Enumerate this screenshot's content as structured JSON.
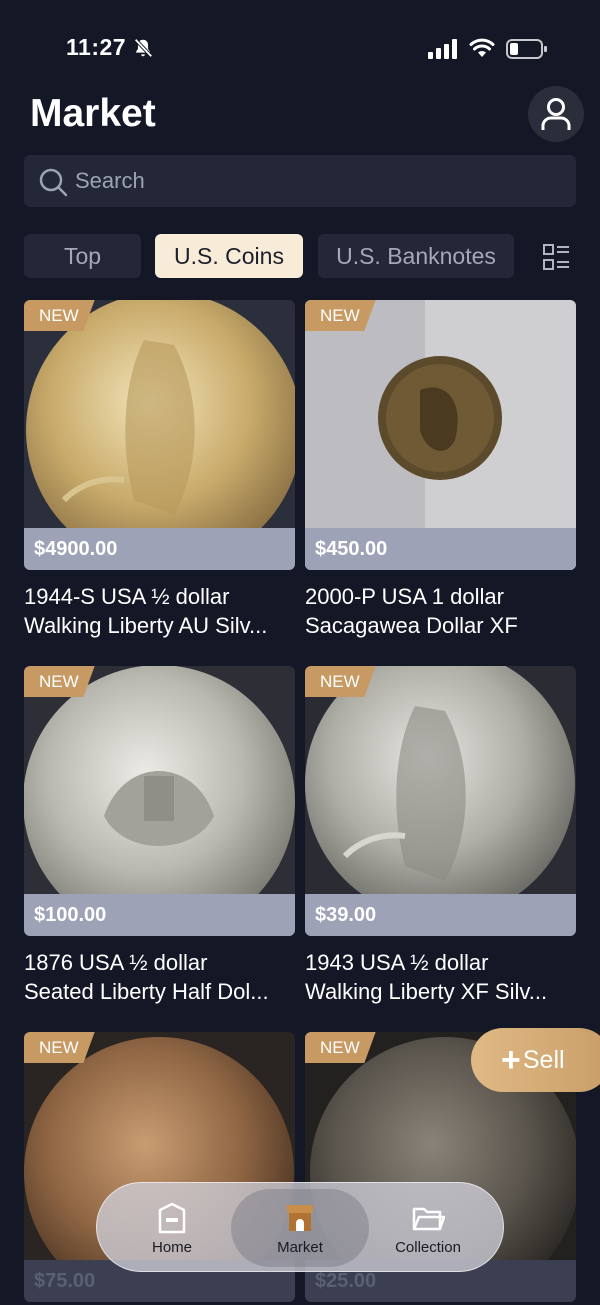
{
  "status_bar": {
    "time": "11:27",
    "icons": [
      "bell-slash-icon",
      "signal-icon",
      "wifi-icon",
      "battery-icon"
    ]
  },
  "header": {
    "title": "Market",
    "avatar_icon": "person-icon"
  },
  "search": {
    "placeholder": "Search",
    "icon": "search-icon"
  },
  "tabs": [
    {
      "label": "Top",
      "active": false
    },
    {
      "label": "U.S. Coins",
      "active": true
    },
    {
      "label": "U.S. Banknotes",
      "active": false
    }
  ],
  "layout_toggle_icon": "list-grid-icon",
  "listings": [
    {
      "badge": "NEW",
      "price": "$4900.00",
      "title_line1": "1944-S USA ½ dollar",
      "title_line2": "Walking Liberty AU Silv..."
    },
    {
      "badge": "NEW",
      "price": "$450.00",
      "title_line1": "2000-P USA 1 dollar",
      "title_line2": "Sacagawea Dollar XF"
    },
    {
      "badge": "NEW",
      "price": "$100.00",
      "title_line1": "1876 USA ½ dollar",
      "title_line2": "Seated Liberty Half Dol..."
    },
    {
      "badge": "NEW",
      "price": "$39.00",
      "title_line1": "1943 USA ½ dollar",
      "title_line2": "Walking Liberty XF Silv..."
    },
    {
      "badge": "NEW",
      "price": "$75.00",
      "title_line1": "",
      "title_line2": ""
    },
    {
      "badge": "NEW",
      "price": "$25.00",
      "title_line1": "",
      "title_line2": ""
    }
  ],
  "sell_button": {
    "label": "Sell",
    "icon": "plus-icon"
  },
  "bottom_nav": [
    {
      "label": "Home",
      "icon": "home-icon",
      "active": false
    },
    {
      "label": "Market",
      "icon": "store-icon",
      "active": true
    },
    {
      "label": "Collection",
      "icon": "folder-icon",
      "active": false
    }
  ],
  "colors": {
    "background": "#141726",
    "surface": "#232737",
    "accent_gold": "#c79a63",
    "active_tab": "#f8ecd9",
    "price_strip": "#9da2b7"
  }
}
